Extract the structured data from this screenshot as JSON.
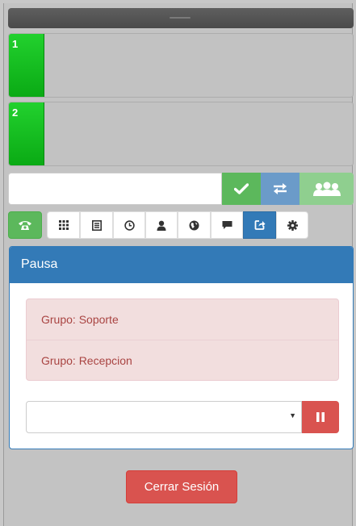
{
  "lines": [
    {
      "number": "1"
    },
    {
      "number": "2"
    }
  ],
  "dialer": {
    "value": "",
    "placeholder": "",
    "buttons": [
      {
        "icon": "check-icon"
      },
      {
        "icon": "transfer-icon"
      },
      {
        "icon": "conference-icon"
      }
    ]
  },
  "toolbar": {
    "phone_icon": "phone-icon",
    "tabs": [
      {
        "icon": "keypad-icon"
      },
      {
        "icon": "list-icon"
      },
      {
        "icon": "clock-icon"
      },
      {
        "icon": "user-icon"
      },
      {
        "icon": "globe-icon"
      },
      {
        "icon": "chat-icon"
      },
      {
        "icon": "share-icon",
        "active": true
      },
      {
        "icon": "gear-icon"
      }
    ]
  },
  "pause_panel": {
    "title": "Pausa",
    "groups": [
      "Grupo: Soporte",
      "Grupo: Recepcion"
    ],
    "select_value": "",
    "pause_icon": "pause-icon"
  },
  "logout_label": "Cerrar Sesión",
  "colors": {
    "primary": "#337ab7",
    "success": "#5cb85c",
    "danger": "#d9534f",
    "line_green": "#0aaa14"
  }
}
